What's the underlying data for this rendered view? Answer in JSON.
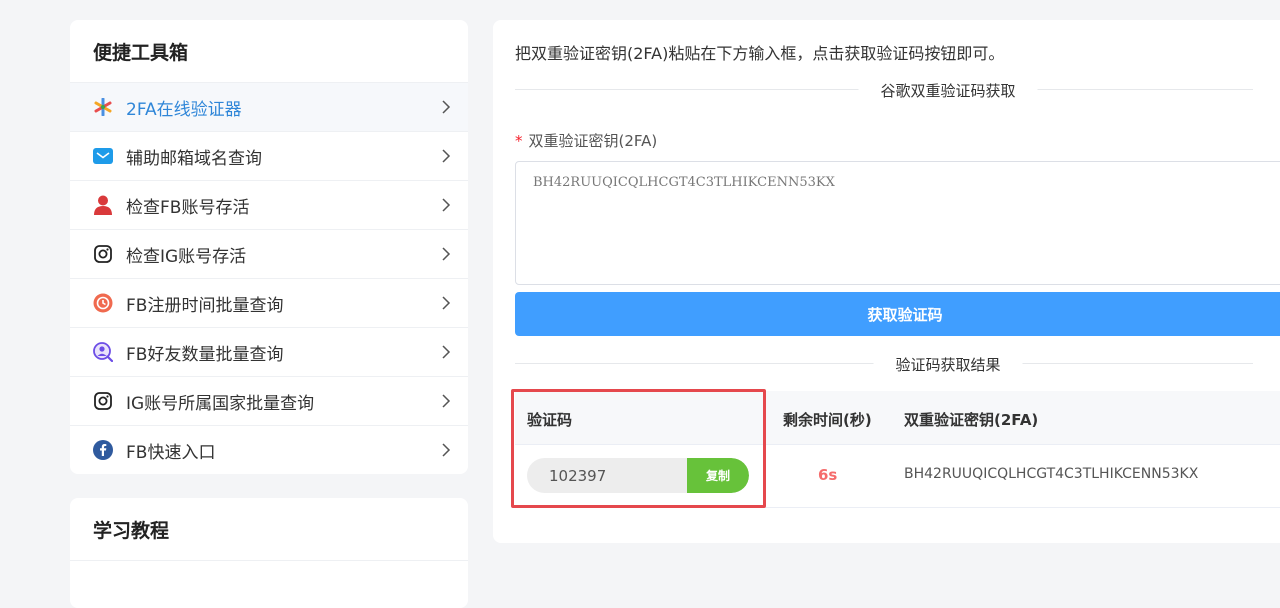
{
  "sidebar": {
    "tools_title": "便捷工具箱",
    "items": [
      {
        "label": "2FA在线验证器",
        "icon": "pinwheel-icon",
        "active": true
      },
      {
        "label": "辅助邮箱域名查询",
        "icon": "mail-icon"
      },
      {
        "label": "检查FB账号存活",
        "icon": "user-icon"
      },
      {
        "label": "检查IG账号存活",
        "icon": "instagram-icon"
      },
      {
        "label": "FB注册时间批量查询",
        "icon": "clock-icon"
      },
      {
        "label": "FB好友数量批量查询",
        "icon": "search-user-icon"
      },
      {
        "label": "IG账号所属国家批量查询",
        "icon": "instagram-icon"
      },
      {
        "label": "FB快速入口",
        "icon": "facebook-icon"
      }
    ],
    "learn_title": "学习教程"
  },
  "main": {
    "intro": "把双重验证密钥(2FA)粘贴在下方输入框，点击获取验证码按钮即可。",
    "section_title": "谷歌双重验证码获取",
    "field_label": "双重验证密钥(2FA)",
    "required_mark": "*",
    "secret_value": "BH42RUUQICQLHCGT4C3TLHIKCENN53KX",
    "get_button": "获取验证码",
    "result_title": "验证码获取结果",
    "table": {
      "headers": [
        "验证码",
        "剩余时间(秒)",
        "双重验证密钥(2FA)"
      ],
      "row": {
        "code": "102397",
        "copy_label": "复制",
        "remaining": "6s",
        "secret": "BH42RUUQICQLHCGT4C3TLHIKCENN53KX"
      }
    }
  },
  "colors": {
    "accent": "#409eff",
    "active_text": "#2f86d8",
    "copy": "#67c23a",
    "timer": "#f56c6c",
    "highlight": "#e5484d"
  }
}
